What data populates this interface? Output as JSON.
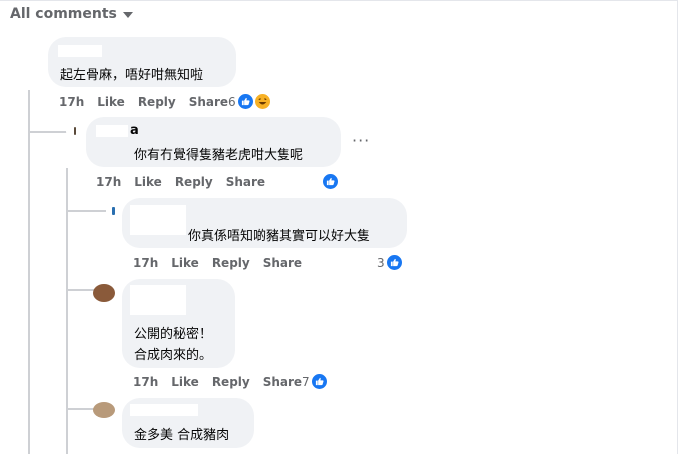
{
  "filter": {
    "label": "All comments"
  },
  "comments": [
    {
      "text": "起左骨麻，唔好咁無知啦",
      "time": "17h",
      "like": "Like",
      "reply": "Reply",
      "share": "Share",
      "reactions": "6"
    },
    {
      "name_fragment": "a",
      "text": "你有冇覺得隻豬老虎咁大隻呢",
      "time": "17h",
      "like": "Like",
      "reply": "Reply",
      "share": "Share",
      "more": "···"
    },
    {
      "text": "你真係唔知啲豬其實可以好大隻",
      "time": "17h",
      "like": "Like",
      "reply": "Reply",
      "share": "Share",
      "reactions": "3"
    },
    {
      "line1": "公開的秘密！",
      "line2": "合成肉來的。",
      "time": "17h",
      "like": "Like",
      "reply": "Reply",
      "share": "Share",
      "reactions": "7"
    },
    {
      "text": "金多美 合成豬肉"
    }
  ],
  "colors": {
    "like_blue": "#1877f2",
    "bubble_gray": "#f0f2f5",
    "muted": "#65676b"
  }
}
